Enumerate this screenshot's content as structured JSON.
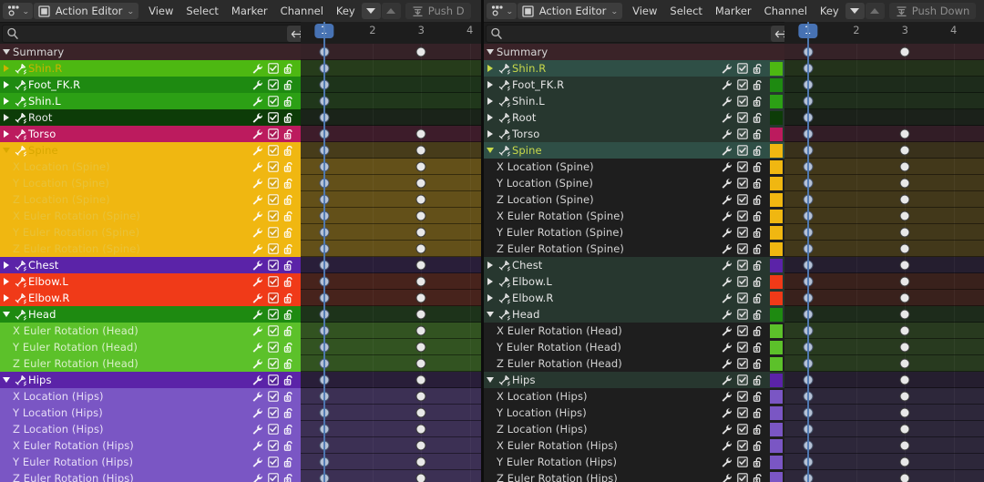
{
  "app": {
    "editor_icon": "action-editor-icon",
    "editor_type": "Action Editor",
    "menus": [
      "View",
      "Select",
      "Marker",
      "Channel",
      "Key"
    ],
    "push_down_label": "Push Down",
    "push_down_label_truncated": "Push D"
  },
  "filter": {
    "search_value": "",
    "search_placeholder": "",
    "search_icon": "search-icon",
    "swap_icon": "left-right-arrows-icon"
  },
  "timeline": {
    "current_frame": "1",
    "ticks": [
      "2",
      "3",
      "4"
    ],
    "keyframe_frames": [
      1,
      3
    ]
  },
  "colors": {
    "accent_blue": "#4772b3",
    "playhead": "#4f7ab5",
    "summary_row": "#3a2328",
    "group_bright_green": "#4db812",
    "group_green": "#1e8a11",
    "group_dark_green": "#0d3c08",
    "group_crimson": "#bc1b5e",
    "group_yellow": "#f0b711",
    "group_purple": "#5b23a8",
    "group_orange_red": "#f03a18"
  },
  "channels": [
    {
      "name": "Summary",
      "type": "summary",
      "expanded": true,
      "indent": 0,
      "color": "",
      "keys": [
        1,
        3
      ],
      "selected": false,
      "has_icons": false
    },
    {
      "name": "Shin.R",
      "type": "group",
      "expanded": false,
      "indent": 0,
      "color": "#4db812",
      "text_color": "#c9b400",
      "keys": [
        1
      ],
      "selected": true,
      "has_icons": true
    },
    {
      "name": "Foot_FK.R",
      "type": "group",
      "expanded": false,
      "indent": 0,
      "color": "#1e8a11",
      "text_color": "#ffffff",
      "keys": [
        1
      ],
      "selected": false,
      "has_icons": true
    },
    {
      "name": "Shin.L",
      "type": "group",
      "expanded": false,
      "indent": 0,
      "color": "#2ca015",
      "text_color": "#ffffff",
      "keys": [
        1
      ],
      "selected": false,
      "has_icons": true
    },
    {
      "name": "Root",
      "type": "group",
      "expanded": false,
      "indent": 0,
      "color": "#0d3c08",
      "text_color": "#e8e8e8",
      "keys": [
        1
      ],
      "selected": false,
      "has_icons": true
    },
    {
      "name": "Torso",
      "type": "group",
      "expanded": false,
      "indent": 0,
      "color": "#bc1b5e",
      "text_color": "#ffffff",
      "keys": [
        1,
        3
      ],
      "selected": false,
      "has_icons": true
    },
    {
      "name": "Spine",
      "type": "group",
      "expanded": true,
      "indent": 0,
      "color": "#f0b711",
      "text_color": "#d8a800",
      "keys": [
        1,
        3
      ],
      "selected": true,
      "has_icons": true
    },
    {
      "name": "X Location (Spine)",
      "type": "fcurve",
      "indent": 1,
      "color": "#f0b711",
      "text_color": "#e8c23a",
      "keys": [
        1,
        3
      ],
      "selected": false,
      "has_icons": true
    },
    {
      "name": "Y Location (Spine)",
      "type": "fcurve",
      "indent": 1,
      "color": "#f0b711",
      "text_color": "#e8c23a",
      "keys": [
        1,
        3
      ],
      "selected": false,
      "has_icons": true
    },
    {
      "name": "Z Location (Spine)",
      "type": "fcurve",
      "indent": 1,
      "color": "#f0b711",
      "text_color": "#e8c23a",
      "keys": [
        1,
        3
      ],
      "selected": false,
      "has_icons": true
    },
    {
      "name": "X Euler Rotation (Spine)",
      "type": "fcurve",
      "indent": 1,
      "color": "#f0b711",
      "text_color": "#e8c23a",
      "keys": [
        1,
        3
      ],
      "selected": false,
      "has_icons": true
    },
    {
      "name": "Y Euler Rotation (Spine)",
      "type": "fcurve",
      "indent": 1,
      "color": "#f0b711",
      "text_color": "#e8c23a",
      "keys": [
        1,
        3
      ],
      "selected": false,
      "has_icons": true
    },
    {
      "name": "Z Euler Rotation (Spine)",
      "type": "fcurve",
      "indent": 1,
      "color": "#f0b711",
      "text_color": "#e8c23a",
      "keys": [
        1,
        3
      ],
      "selected": false,
      "has_icons": true
    },
    {
      "name": "Chest",
      "type": "group",
      "expanded": false,
      "indent": 0,
      "color": "#5b23a8",
      "text_color": "#ffffff",
      "keys": [
        1,
        3
      ],
      "selected": false,
      "has_icons": true
    },
    {
      "name": "Elbow.L",
      "type": "group",
      "expanded": false,
      "indent": 0,
      "color": "#f03a18",
      "text_color": "#ffffff",
      "keys": [
        1,
        3
      ],
      "selected": false,
      "has_icons": true
    },
    {
      "name": "Elbow.R",
      "type": "group",
      "expanded": false,
      "indent": 0,
      "color": "#f03a18",
      "text_color": "#ffffff",
      "keys": [
        1,
        3
      ],
      "selected": false,
      "has_icons": true
    },
    {
      "name": "Head",
      "type": "group",
      "expanded": true,
      "indent": 0,
      "color": "#1e8a11",
      "text_color": "#ffffff",
      "keys": [
        1,
        3
      ],
      "selected": false,
      "has_icons": true
    },
    {
      "name": "X Euler Rotation (Head)",
      "type": "fcurve",
      "indent": 1,
      "color": "#5cc12a",
      "text_color": "#d8f0c8",
      "keys": [
        1,
        3
      ],
      "selected": false,
      "has_icons": true
    },
    {
      "name": "Y Euler Rotation (Head)",
      "type": "fcurve",
      "indent": 1,
      "color": "#5cc12a",
      "text_color": "#d8f0c8",
      "keys": [
        1,
        3
      ],
      "selected": false,
      "has_icons": true
    },
    {
      "name": "Z Euler Rotation (Head)",
      "type": "fcurve",
      "indent": 1,
      "color": "#5cc12a",
      "text_color": "#d8f0c8",
      "keys": [
        1,
        3
      ],
      "selected": false,
      "has_icons": true
    },
    {
      "name": "Hips",
      "type": "group",
      "expanded": true,
      "indent": 0,
      "color": "#5b23a8",
      "text_color": "#ffffff",
      "keys": [
        1,
        3
      ],
      "selected": false,
      "has_icons": true
    },
    {
      "name": "X Location (Hips)",
      "type": "fcurve",
      "indent": 1,
      "color": "#7a56c4",
      "text_color": "#e6ddf6",
      "keys": [
        1,
        3
      ],
      "selected": false,
      "has_icons": true
    },
    {
      "name": "Y Location (Hips)",
      "type": "fcurve",
      "indent": 1,
      "color": "#7a56c4",
      "text_color": "#e6ddf6",
      "keys": [
        1,
        3
      ],
      "selected": false,
      "has_icons": true
    },
    {
      "name": "Z Location (Hips)",
      "type": "fcurve",
      "indent": 1,
      "color": "#7a56c4",
      "text_color": "#e6ddf6",
      "keys": [
        1,
        3
      ],
      "selected": false,
      "has_icons": true
    },
    {
      "name": "X Euler Rotation (Hips)",
      "type": "fcurve",
      "indent": 1,
      "color": "#7a56c4",
      "text_color": "#e6ddf6",
      "keys": [
        1,
        3
      ],
      "selected": false,
      "has_icons": true
    },
    {
      "name": "Y Euler Rotation (Hips)",
      "type": "fcurve",
      "indent": 1,
      "color": "#7a56c4",
      "text_color": "#e6ddf6",
      "keys": [
        1,
        3
      ],
      "selected": false,
      "has_icons": true
    },
    {
      "name": "Z Euler Rotation (Hips)",
      "type": "fcurve",
      "indent": 1,
      "color": "#7a56c4",
      "text_color": "#e6ddf6",
      "keys": [
        1,
        3
      ],
      "selected": false,
      "has_icons": true
    }
  ],
  "row_icons": {
    "modifier": "wrench-icon",
    "mute": "checkbox-icon",
    "lock": "unlocked-padlock-icon",
    "bone": "animated-bone-icon",
    "expand": "disclosure-triangle-icon"
  }
}
